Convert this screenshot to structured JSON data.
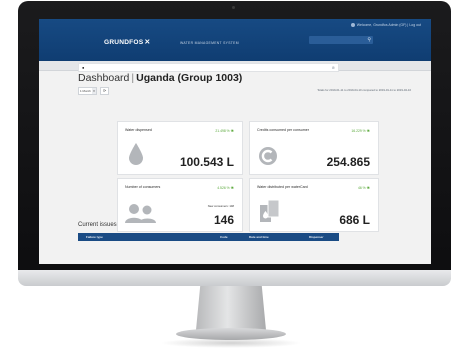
{
  "header": {
    "user_info": "Welcome, Grundfos Admin (GF) | Log out",
    "logo": "GRUNDFOS",
    "logo_mark": "✕",
    "subtitle": "WATER MANAGEMENT SYSTEM",
    "search_placeholder": ""
  },
  "nav": {
    "items": [
      {
        "label": "DASHBOARD",
        "active": true
      },
      {
        "label": "REPORTS",
        "active": false
      },
      {
        "label": "LOGS",
        "active": false
      },
      {
        "label": "SETTINGS",
        "active": false
      },
      {
        "label": "HELP AND SUPPORT",
        "active": false
      }
    ]
  },
  "filter": {
    "dot": "●",
    "end": "⊗"
  },
  "title": {
    "prefix": "Dashboard",
    "sep": "|",
    "group": "Uganda (Group 1003)"
  },
  "controls": {
    "period": "1 Month",
    "refresh": "⟳",
    "date_range": "Totals for 2019-01-11 to 2019-04-10 compared to 2019-01-11 to 2019-04-10"
  },
  "cards": [
    {
      "label": "Water dispensed",
      "pct": "21.498 %",
      "value": "100.543 L",
      "icon": "water-drop-icon"
    },
    {
      "label": "Credits consumed per consumer",
      "pct": "16.229 %",
      "value": "254.865",
      "icon": "credits-coin-icon"
    },
    {
      "label": "Number of consumers",
      "pct": "4.526 %",
      "sub": "New consumers: 148",
      "value": "146",
      "icon": "consumers-icon"
    },
    {
      "label": "Water distributed per waterCard",
      "pct": "46 %",
      "value": "686 L",
      "icon": "watercards-icon"
    }
  ],
  "issues": {
    "title": "Current issues",
    "columns": [
      "Failure type",
      "Code",
      "Date and time",
      "Dispenser"
    ]
  },
  "colors": {
    "brand": "#174a83",
    "positive": "#59a83a"
  }
}
